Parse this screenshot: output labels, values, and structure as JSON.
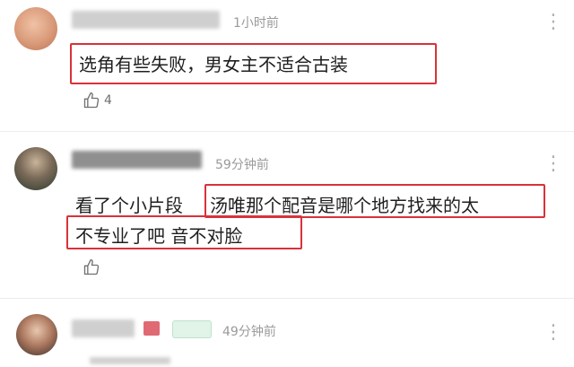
{
  "comments": [
    {
      "time": "1小时前",
      "text": "选角有些失败，男女主不适合古装",
      "likes": "4"
    },
    {
      "time": "59分钟前",
      "text_prefix": "看了个小片段",
      "text_highlight_1": "汤唯那个配音是哪个地方找来的太",
      "text_highlight_2": "不专业了吧 音不对脸"
    },
    {
      "time": "49分钟前"
    }
  ],
  "icons": {
    "more": "more-vertical-icon",
    "like": "thumbs-up-icon"
  },
  "colors": {
    "highlight_border": "#d8323a",
    "time_text": "#9a9a9a"
  }
}
